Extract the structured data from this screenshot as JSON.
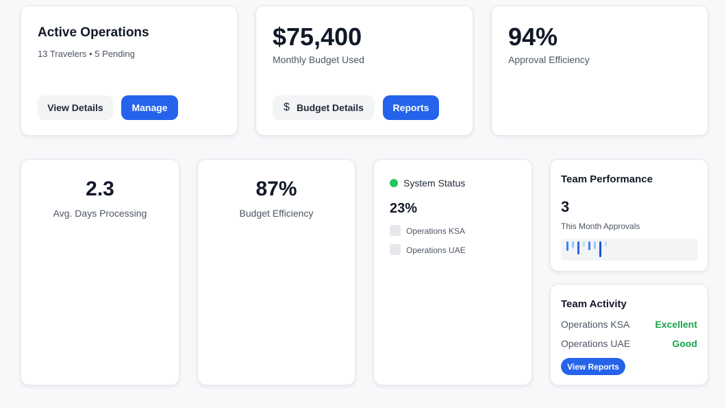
{
  "active_operations": {
    "title": "Active Operations",
    "subtitle": "13 Travelers • 5 Pending",
    "view_details_label": "View Details",
    "manage_label": "Manage"
  },
  "budget": {
    "amount": "$75,400",
    "caption": "Monthly Budget Used",
    "budget_details_label": "Budget Details",
    "reports_label": "Reports",
    "dollar_icon": "dollar-icon"
  },
  "approval": {
    "value": "94%",
    "caption": "Approval Efficiency"
  },
  "processing": {
    "value": "2.3",
    "caption": "Avg. Days Processing"
  },
  "budget_efficiency": {
    "value": "87%",
    "caption": "Budget Efficiency"
  },
  "system_status": {
    "label": "System Status",
    "status_color": "#22c55e",
    "value": "23%",
    "items": [
      {
        "label": "Operations KSA"
      },
      {
        "label": "Operations UAE"
      }
    ]
  },
  "team_performance": {
    "title": "Team Performance",
    "value": "3",
    "caption": "This Month Approvals"
  },
  "team_activity": {
    "title": "Team Activity",
    "rows": [
      {
        "team": "Operations KSA",
        "rating": "Excellent"
      },
      {
        "team": "Operations UAE",
        "rating": "Good"
      }
    ],
    "rating_color": "#16a34a",
    "view_reports_label": "View Reports"
  },
  "colors": {
    "accent": "#2563eb",
    "background": "#f7f8fa"
  }
}
